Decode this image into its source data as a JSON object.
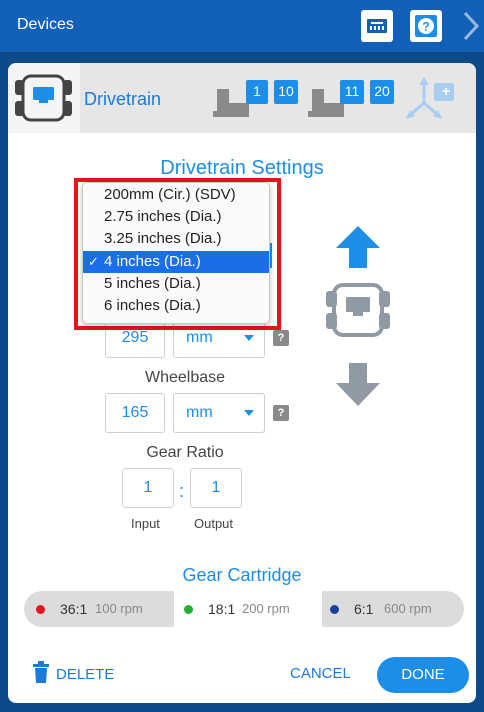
{
  "header": {
    "title": "Devices",
    "keyboard_icon": "brain-port-icon",
    "help_icon": "help-icon",
    "next_icon": "chevron-right-icon"
  },
  "tabs": {
    "active_label": "Drivetrain",
    "left_motor_ports": [
      "1",
      "10"
    ],
    "right_motor_ports": [
      "11",
      "20"
    ],
    "gyro_label": "+"
  },
  "settings": {
    "title": "Drivetrain Settings",
    "wheel_dropdown": {
      "options": [
        "200mm (Cir.) (SDV)",
        "2.75 inches (Dia.)",
        "3.25 inches (Dia.)",
        "4 inches (Dia.)",
        "5 inches (Dia.)",
        "6 inches (Dia.)"
      ],
      "selected": "4 inches (Dia.)",
      "check": "✓"
    },
    "track_width": {
      "value": "295",
      "unit": "mm",
      "help": "?"
    },
    "wheelbase": {
      "label": "Wheelbase",
      "value": "165",
      "unit": "mm",
      "help": "?"
    },
    "gear_ratio": {
      "label": "Gear Ratio",
      "input_value": "1",
      "output_value": "1",
      "separator": ":",
      "input_label": "Input",
      "output_label": "Output"
    }
  },
  "gear_cartridge": {
    "title": "Gear Cartridge",
    "options": [
      {
        "ratio": "36:1",
        "rpm": "100 rpm",
        "color": "#e8141b"
      },
      {
        "ratio": "18:1",
        "rpm": "200 rpm",
        "color": "#22b02f"
      },
      {
        "ratio": "6:1",
        "rpm": "600 rpm",
        "color": "#1a3fa0"
      }
    ],
    "selected": "18:1"
  },
  "footer": {
    "delete_label": "DELETE",
    "cancel_label": "CANCEL",
    "done_label": "DONE"
  },
  "colors": {
    "accent": "#1c8ee8",
    "header": "#1260b8",
    "highlight_frame": "#e8141b",
    "arrow_forward": "#1c8ee8",
    "arrow_reverse": "#8f9aa5"
  }
}
